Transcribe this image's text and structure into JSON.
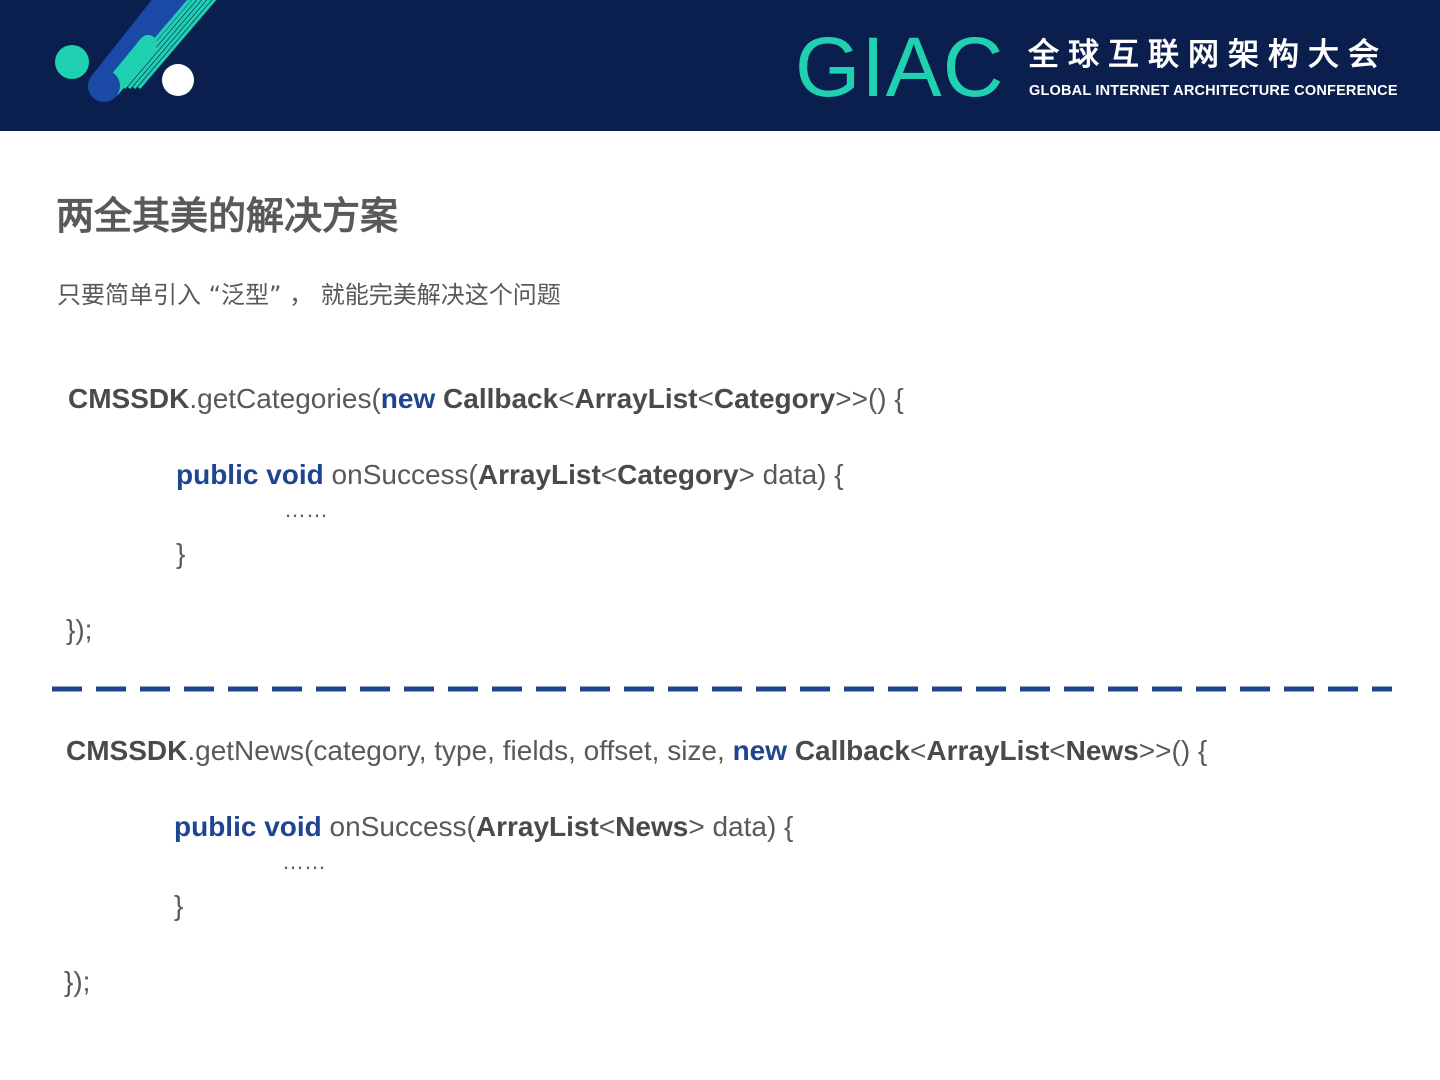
{
  "header": {
    "logo_text": "GIAC",
    "conference_cn": "全球互联网架构大会",
    "conference_en": "GLOBAL INTERNET ARCHITECTURE CONFERENCE",
    "colors": {
      "banner": "#0b1f4e",
      "accent": "#1fd1b0",
      "accent_dark": "#1b4aa6"
    }
  },
  "slide": {
    "title": "两全其美的解决方案",
    "subtitle": "只要简单引入 “泛型” ， 就能完美解决这个问题"
  },
  "code_block_1": {
    "l1": {
      "obj": "CMSSDK",
      "call": ".getCategories(",
      "kw_new": "new",
      "cb": "Callback",
      "lt1": "<",
      "type1": "ArrayList",
      "lt2": "<",
      "type2": "Category",
      "tail": ">>() {"
    },
    "l2": {
      "kw": "public void",
      "method": " onSuccess(",
      "type1": "ArrayList",
      "lt": "<",
      "type2": "Category",
      "tail": "> data) {"
    },
    "dots": "……",
    "close_inner": "}",
    "close_outer": "});"
  },
  "code_block_2": {
    "l1": {
      "obj": "CMSSDK",
      "call": ".getNews(category, type, fields, offset, size, ",
      "kw_new": "new",
      "cb": "Callback",
      "lt1": "<",
      "type1": "ArrayList",
      "lt2": "<",
      "type2": "News",
      "tail": ">>() {"
    },
    "l2": {
      "kw": "public void",
      "method": " onSuccess(",
      "type1": "ArrayList",
      "lt": "<",
      "type2": "News",
      "tail": "> data) {"
    },
    "dots": "……",
    "close_inner": "}",
    "close_outer": "});"
  }
}
